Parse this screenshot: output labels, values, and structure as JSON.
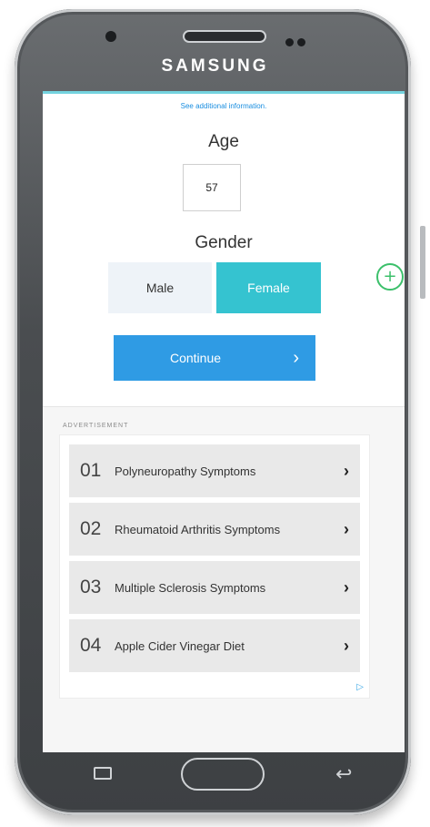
{
  "device": {
    "brand": "SAMSUNG"
  },
  "form": {
    "info_link": "See additional information.",
    "age_label": "Age",
    "age_value": "57",
    "gender_label": "Gender",
    "gender_options": [
      "Male",
      "Female"
    ],
    "gender_selected": "Female",
    "continue_label": "Continue",
    "continue_icon": "chevron-right"
  },
  "ad": {
    "label": "ADVERTISEMENT",
    "items": [
      {
        "num": "01",
        "title": "Polyneuropathy Symptoms"
      },
      {
        "num": "02",
        "title": "Rheumatoid Arthritis Symptoms"
      },
      {
        "num": "03",
        "title": "Multiple Sclerosis Symptoms"
      },
      {
        "num": "04",
        "title": "Apple Cider Vinegar Diet"
      }
    ],
    "choices_icon": "adchoices-triangle-icon"
  },
  "floating": {
    "icon": "plus-icon"
  },
  "colors": {
    "female_selected": "#35c3d0",
    "continue": "#2f9be4",
    "link": "#1a8ee0",
    "plus": "#3cc06b"
  }
}
